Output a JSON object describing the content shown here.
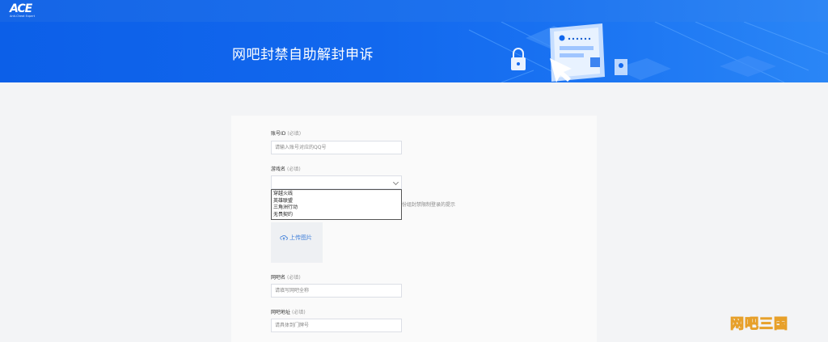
{
  "header": {
    "logo_text": "ACE",
    "logo_sub": "Anti-Cheat Expert"
  },
  "banner": {
    "title": "网吧封禁自助解封申诉"
  },
  "form": {
    "account": {
      "label": "账号ID",
      "required": "(必填)",
      "placeholder": "请输入账号对应的QQ号"
    },
    "game": {
      "label": "游戏名",
      "required": "(必填)",
      "value": "",
      "options": [
        "穿越火线",
        "英雄联盟",
        "三角洲行动",
        "无畏契约"
      ]
    },
    "hint_text": "份组封禁限制登录的提示",
    "upload": {
      "label": "上传图片"
    },
    "netcafe_name": {
      "label": "网吧名",
      "required": "(必填)",
      "placeholder": "请填写网吧全称"
    },
    "netcafe_address": {
      "label": "网吧地址",
      "required": "(必填)",
      "placeholder": "请具体到门牌号"
    }
  },
  "watermark": {
    "text": "网吧三国"
  },
  "colors": {
    "brand_blue": "#1268ee",
    "link_blue": "#3b7cd9",
    "watermark_gold": "#f7c35a"
  }
}
